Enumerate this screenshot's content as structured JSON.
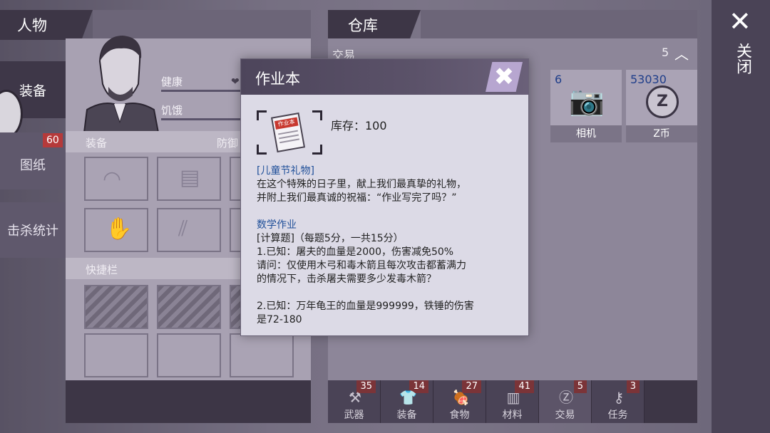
{
  "character": {
    "header_title": "人物",
    "tabs": [
      {
        "label": "装备"
      },
      {
        "label": "图纸",
        "badge": "60"
      },
      {
        "label": "击杀统计"
      }
    ],
    "stats": [
      {
        "label": "健康"
      },
      {
        "label": "饥饿"
      }
    ],
    "equipment_label": "装备",
    "defense_label": "防御",
    "quickbar_label": "快捷栏"
  },
  "warehouse": {
    "header_title": "仓库",
    "filter_label": "交易",
    "filter_count": "5",
    "items": [
      {
        "count": "6",
        "name": "相机"
      },
      {
        "count": "53030",
        "name": "Z币"
      }
    ],
    "categories": [
      {
        "label": "武器",
        "badge": "35",
        "icon": "axe-icon"
      },
      {
        "label": "装备",
        "badge": "14",
        "icon": "shirt-icon"
      },
      {
        "label": "食物",
        "badge": "27",
        "icon": "meat-icon"
      },
      {
        "label": "材料",
        "badge": "41",
        "icon": "material-icon"
      },
      {
        "label": "交易",
        "badge": "5",
        "icon": "coin-icon"
      },
      {
        "label": "任务",
        "badge": "3",
        "icon": "key-icon"
      }
    ]
  },
  "close_panel": {
    "label": "关闭"
  },
  "modal": {
    "title": "作业本",
    "stock": "库存：100",
    "item_icon_text": "作业本",
    "lines": [
      {
        "text": "[儿童节礼物]",
        "blue": true
      },
      {
        "text": "在这个特殊的日子里，献上我们最真挚的礼物，",
        "blue": false
      },
      {
        "text": "并附上我们最真诚的祝福：“作业写完了吗？”",
        "blue": false
      },
      {
        "text": "",
        "blue": false
      },
      {
        "text": "数学作业",
        "blue": true
      },
      {
        "text": "[计算题]（每题5分，一共15分）",
        "blue": false
      },
      {
        "text": "1.已知：屠夫的血量是2000，伤害减免50%",
        "blue": false
      },
      {
        "text": "请问：仅使用木弓和毒木箭且每次攻击都蓄满力",
        "blue": false
      },
      {
        "text": "的情况下，击杀屠夫需要多少发毒木箭？",
        "blue": false
      },
      {
        "text": "",
        "blue": false
      },
      {
        "text": "2.已知：万年龟王的血量是999999，铁锤的伤害",
        "blue": false
      },
      {
        "text": "是72-180",
        "blue": false
      }
    ]
  },
  "colors": {
    "accent_blue": "#1f4f99",
    "badge_red": "#b53a3a",
    "panel_dark": "#3d3646"
  }
}
